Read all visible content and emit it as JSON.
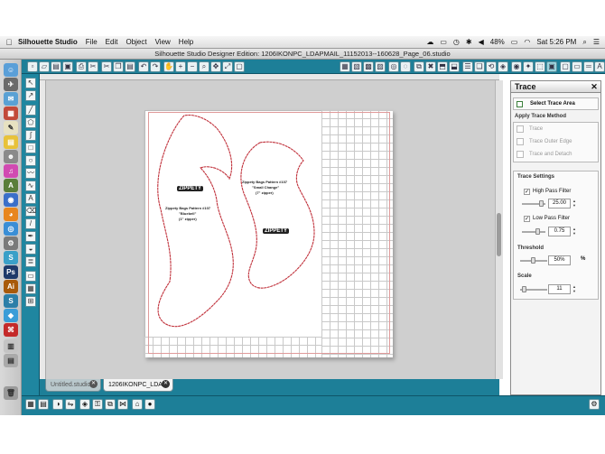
{
  "menubar": {
    "apple": "",
    "app_name": "Silhouette Studio",
    "items": [
      "File",
      "Edit",
      "Object",
      "View",
      "Help"
    ],
    "battery": "48%",
    "clock": "Sat 5:26 PM"
  },
  "window": {
    "title": "Silhouette Studio Designer Edition: 1206IKONPC_LDAPMAIL_11152013--160628_Page_06.studio"
  },
  "document": {
    "pattern1_title": "Zippety Bags Pattern #107",
    "pattern1_sub1": "\"Bluebell\"",
    "pattern1_sub2": "(1\" zipper)",
    "pattern2_title": "Zippety Bags Pattern #107",
    "pattern2_sub1": "\"Small Change\"",
    "pattern2_sub2": "(7\" zipper)",
    "logo_text": "ZIPPETY"
  },
  "trace_panel": {
    "title": "Trace",
    "close": "✕",
    "select_trace_area": "Select Trace Area",
    "apply_method_label": "Apply Trace Method",
    "btn_trace": "Trace",
    "btn_outer_edge": "Trace Outer Edge",
    "btn_detach": "Trace and Detach",
    "settings_label": "Trace Settings",
    "high_pass_label": "High Pass Filter",
    "high_pass_value": "25.00",
    "high_pass_checked": "✓",
    "low_pass_label": "Low Pass Filter",
    "low_pass_value": "0.75",
    "low_pass_checked": "✓",
    "threshold_label": "Threshold",
    "threshold_value": "50%",
    "threshold_unit": "%",
    "scale_label": "Scale",
    "scale_value": "11"
  },
  "tabs": [
    {
      "label": "Untitled.studio",
      "close": "✕"
    },
    {
      "label": "1206IKONPC_LDA...",
      "close": "✕"
    }
  ],
  "colors": {
    "chrome_teal": "#1d7f98",
    "cut_line": "#c0303a"
  }
}
